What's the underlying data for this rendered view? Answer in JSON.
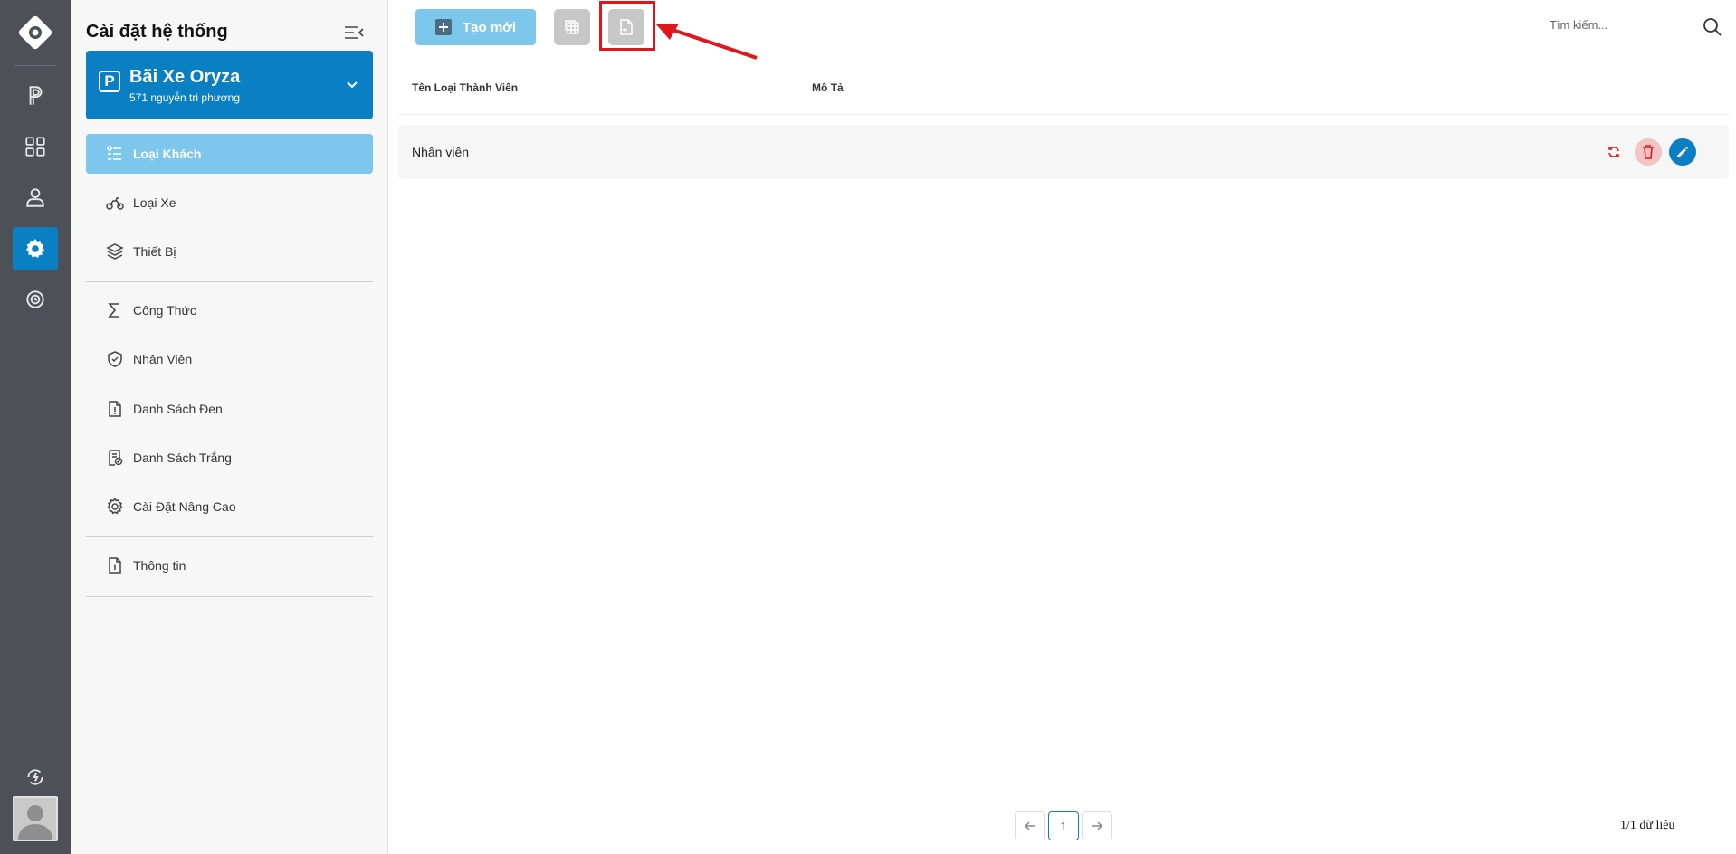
{
  "sidebar": {
    "title": "Cài đặt hệ thống",
    "lot": {
      "name": "Bãi Xe Oryza",
      "address": "571 nguyễn tri phương",
      "badge": "P"
    },
    "items": [
      {
        "label": "Loại Khách",
        "icon": "user-list-icon",
        "active": true
      },
      {
        "label": "Loại Xe",
        "icon": "motorbike-icon",
        "active": false
      },
      {
        "label": "Thiết Bị",
        "icon": "layers-icon",
        "active": false
      },
      {
        "label": "Công Thức",
        "icon": "sigma-icon",
        "active": false
      },
      {
        "label": "Nhân Viên",
        "icon": "shield-check-icon",
        "active": false
      },
      {
        "label": "Danh Sách Đen",
        "icon": "file-alert-icon",
        "active": false
      },
      {
        "label": "Danh Sách Trắng",
        "icon": "file-check-icon",
        "active": false
      },
      {
        "label": "Cài Đặt Nâng Cao",
        "icon": "gear-icon",
        "active": false
      },
      {
        "label": "Thông tin",
        "icon": "file-info-icon",
        "active": false
      }
    ]
  },
  "toolbar": {
    "create_label": "Tạo mới",
    "search_placeholder": "Tìm kiếm..."
  },
  "table": {
    "columns": [
      "Tên Loại Thành Viên",
      "Mô Tả"
    ],
    "rows": [
      {
        "name": "Nhân viên",
        "description": ""
      }
    ]
  },
  "pagination": {
    "current": "1",
    "summary": "1/1 dữ liệu"
  },
  "colors": {
    "primary": "#0a7fc3",
    "light_primary": "#7ec7ec",
    "rail": "#4d5057",
    "highlight": "#e0161b"
  }
}
